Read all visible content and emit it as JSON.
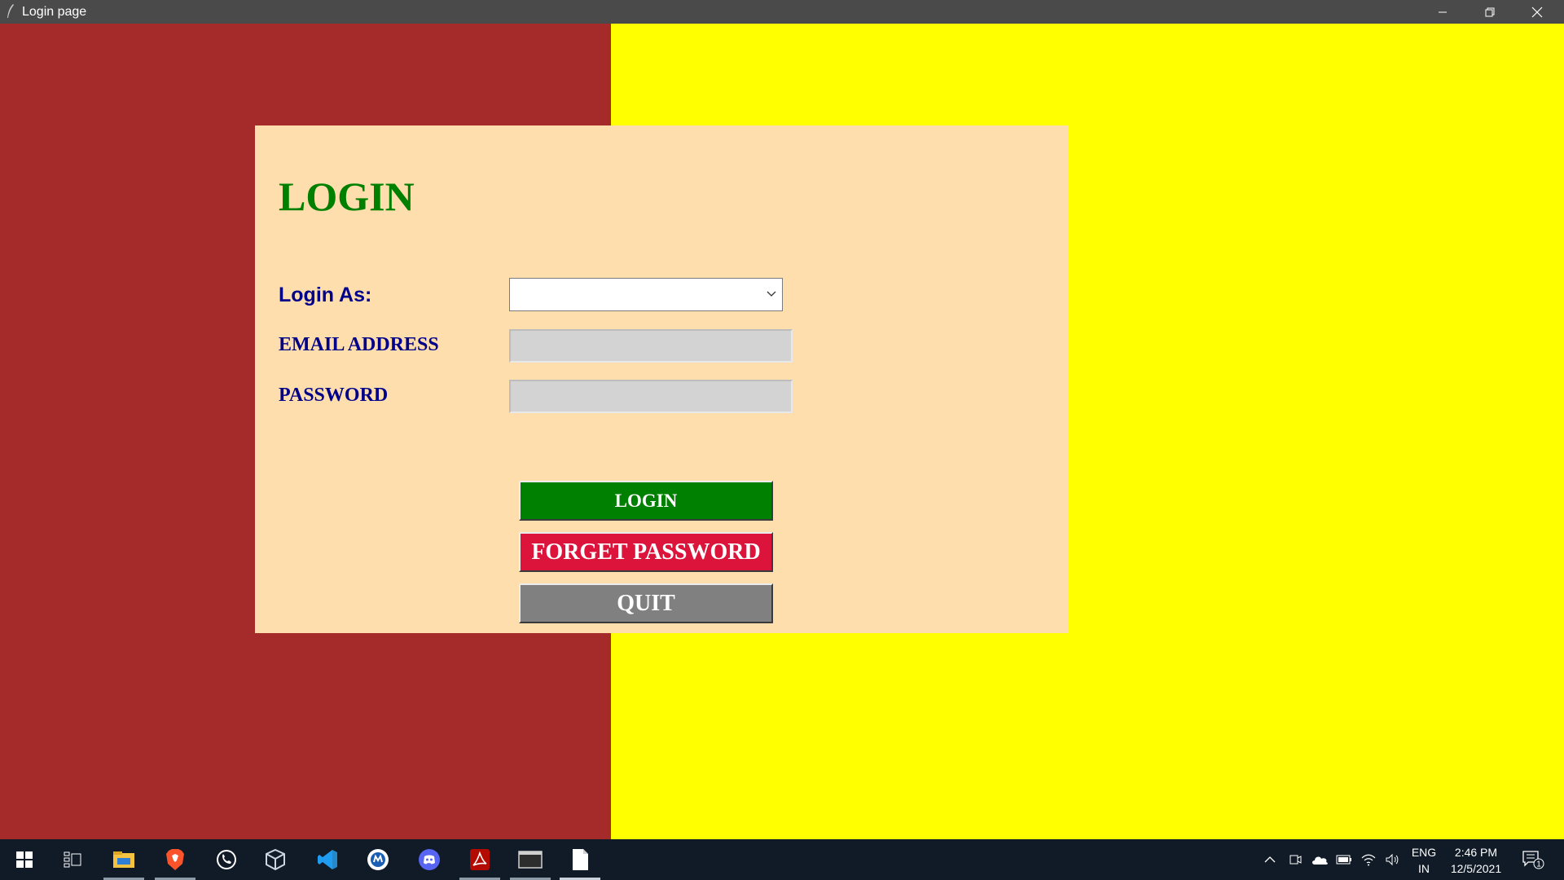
{
  "window": {
    "title": "Login page",
    "controls": {
      "minimize": "minimize-icon",
      "maximize": "restore-icon",
      "close": "close-icon"
    }
  },
  "colors": {
    "left_panel": "#a52a2a",
    "right_panel": "#ffff00",
    "card": "#ffdead",
    "heading": "#008000",
    "labels": "#00008b",
    "login_button": "#008000",
    "forget_button": "#dc143c",
    "quit_button": "#808080"
  },
  "form": {
    "heading": "LOGIN",
    "login_as": {
      "label": "Login As:",
      "selected": ""
    },
    "email": {
      "label": "EMAIL ADDRESS",
      "value": ""
    },
    "password": {
      "label": "PASSWORD",
      "value": ""
    },
    "buttons": {
      "login": "LOGIN",
      "forget": "FORGET PASSWORD",
      "quit": "QUIT"
    }
  },
  "taskbar": {
    "apps": [
      "windows-start-icon",
      "task-view-icon",
      "file-explorer-icon",
      "brave-browser-icon",
      "whatsapp-icon",
      "virtualbox-icon",
      "vscode-icon",
      "app-icon",
      "discord-icon",
      "acrobat-reader-icon",
      "terminal-icon",
      "document-icon"
    ],
    "tray_icons": [
      "show-hidden-icons-chevron",
      "meet-now-icon",
      "onedrive-icon",
      "battery-icon",
      "wifi-icon",
      "volume-icon"
    ],
    "language": {
      "line1": "ENG",
      "line2": "IN"
    },
    "clock": {
      "time": "2:46 PM",
      "date": "12/5/2021"
    },
    "notification_count": "1"
  }
}
